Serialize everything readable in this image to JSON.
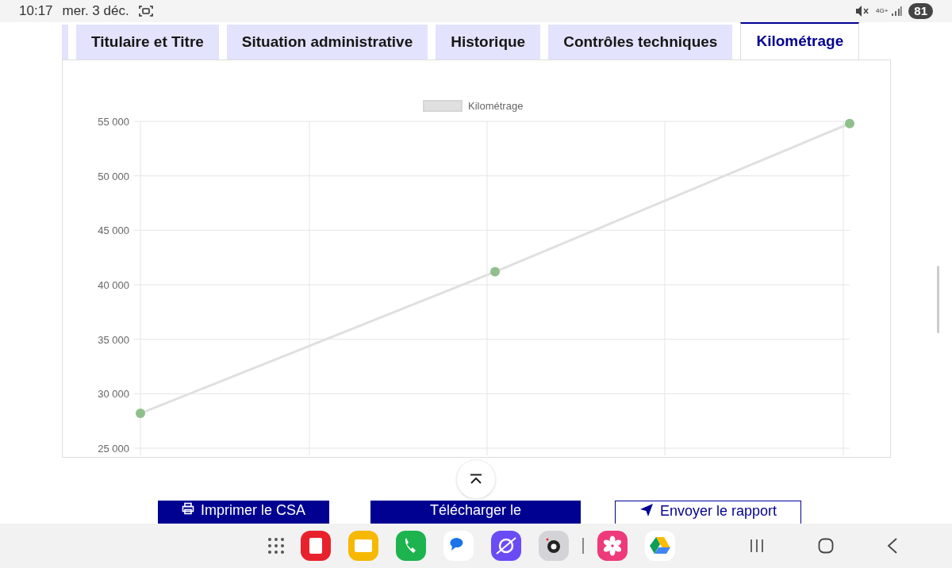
{
  "status_bar": {
    "time": "10:17",
    "date": "mer. 3 déc.",
    "network": "4G+",
    "battery": "81"
  },
  "tabs": [
    {
      "label": "Titulaire et Titre",
      "selected": false
    },
    {
      "label": "Situation administrative",
      "selected": false
    },
    {
      "label": "Historique",
      "selected": false
    },
    {
      "label": "Contrôles techniques",
      "selected": false
    },
    {
      "label": "Kilométrage",
      "selected": true
    }
  ],
  "chart_data": {
    "type": "line",
    "grid": true,
    "ylim": [
      25000,
      55000
    ],
    "yticks": [
      {
        "value": 25000,
        "label": "25 000"
      },
      {
        "value": 30000,
        "label": "30 000"
      },
      {
        "value": 35000,
        "label": "35 000"
      },
      {
        "value": 40000,
        "label": "40 000"
      },
      {
        "value": 45000,
        "label": "45 000"
      },
      {
        "value": 50000,
        "label": "50 000"
      },
      {
        "value": 55000,
        "label": "55 000"
      }
    ],
    "series": [
      {
        "name": "Kilométrage",
        "color": "#e0e0e0",
        "marker": true,
        "values": [
          28200,
          41200,
          54800
        ]
      }
    ]
  },
  "buttons": [
    {
      "label": "Imprimer le CSA",
      "kind": "print"
    },
    {
      "label": "Télécharger le",
      "kind": "download"
    },
    {
      "label": "Envoyer le rapport",
      "kind": "send"
    }
  ]
}
